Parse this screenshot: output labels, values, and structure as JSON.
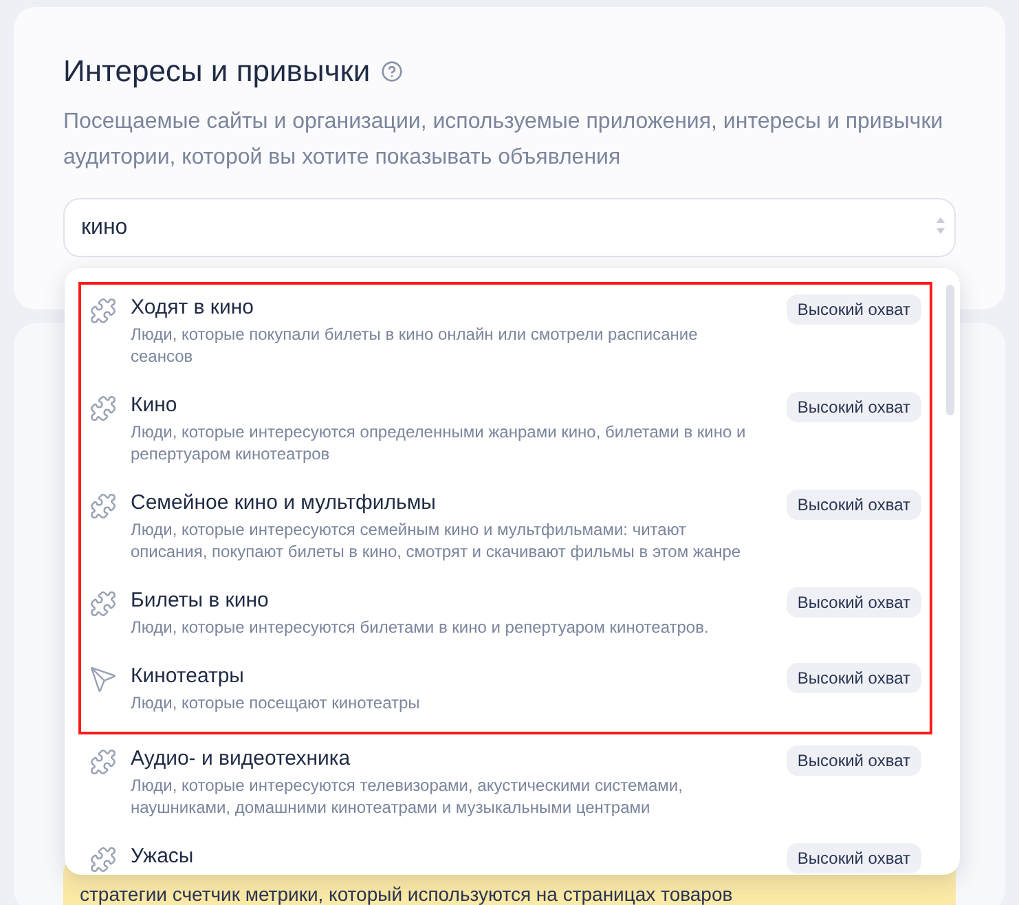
{
  "section": {
    "title": "Интересы и привычки",
    "description": "Посещаемые сайты и организации, используемые приложения, интересы и привычки аудитории, которой вы хотите показывать объявления"
  },
  "search": {
    "value": "кино"
  },
  "background_banner": {
    "text": "стратегии счетчик метрики, который используются на страницах товаров"
  },
  "suggestions": {
    "highlighted": [
      {
        "kind": "puzzle",
        "title": "Ходят в кино",
        "description": "Люди, которые покупали билеты в кино онлайн или смотрели расписание сеансов",
        "badge": "Высокий охват"
      },
      {
        "kind": "puzzle",
        "title": "Кино",
        "description": "Люди, которые интересуются определенными жанрами кино, билетами в кино и репертуаром кинотеатров",
        "badge": "Высокий охват"
      },
      {
        "kind": "puzzle",
        "title": "Семейное кино и мультфильмы",
        "description": "Люди, которые интересуются семейным кино и мультфильмами: читают описания, покупают билеты в кино, смотрят и скачивают фильмы в этом жанре",
        "badge": "Высокий охват"
      },
      {
        "kind": "puzzle",
        "title": "Билеты в кино",
        "description": "Люди, которые интересуются билетами в кино и репертуаром кинотеатров.",
        "badge": "Высокий охват"
      },
      {
        "kind": "place",
        "title": "Кинотеатры",
        "description": "Люди, которые посещают кинотеатры",
        "badge": "Высокий охват"
      }
    ],
    "others": [
      {
        "kind": "puzzle",
        "title": "Аудио- и видеотехника",
        "description": "Люди, которые интересуются телевизорами, акустическими системами, наушниками, домашними кинотеатрами и музыкальными центрами",
        "badge": "Высокий охват"
      },
      {
        "kind": "puzzle",
        "title": "Ужасы",
        "badge": "Высокий охват"
      }
    ]
  }
}
